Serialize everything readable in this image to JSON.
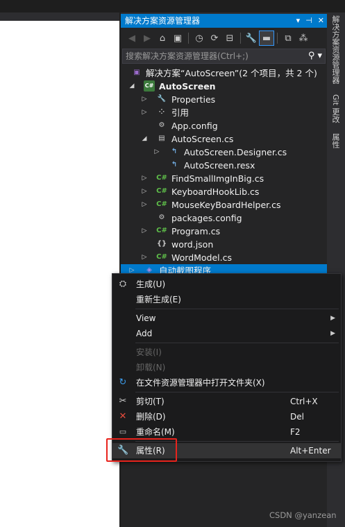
{
  "panel": {
    "title": "解决方案资源管理器",
    "title_buttons": [
      "▾",
      "⊣",
      "✕"
    ]
  },
  "search": {
    "placeholder": "搜索解决方案资源管理器(Ctrl+;)"
  },
  "tree": {
    "solution": "解决方案“AutoScreen”(2 个项目，共 2 个)",
    "project": "AutoScreen",
    "items": [
      "Properties",
      "引用",
      "App.config",
      "AutoScreen.cs",
      "AutoScreen.Designer.cs",
      "AutoScreen.resx",
      "FindSmallImgInBig.cs",
      "KeyboardHookLib.cs",
      "MouseKeyBoardHelper.cs",
      "packages.config",
      "Program.cs",
      "word.json",
      "WordModel.cs"
    ],
    "selected_project": "自动截图程序"
  },
  "context_menu": {
    "build": "生成(U)",
    "rebuild": "重新生成(E)",
    "view": "View",
    "add": "Add",
    "install": "安装(I)",
    "uninstall": "卸载(N)",
    "open_folder": "在文件资源管理器中打开文件夹(X)",
    "cut": "剪切(T)",
    "cut_shortcut": "Ctrl+X",
    "delete": "删除(D)",
    "delete_shortcut": "Del",
    "rename": "重命名(M)",
    "rename_shortcut": "F2",
    "properties": "属性(R)",
    "properties_shortcut": "Alt+Enter"
  },
  "side_tabs": [
    "解决方案资源管理器",
    "Git 更改",
    "属性"
  ],
  "watermark": "CSDN @yanzean",
  "colors": {
    "accent": "#007acc",
    "highlight_box": "#e8231c"
  }
}
